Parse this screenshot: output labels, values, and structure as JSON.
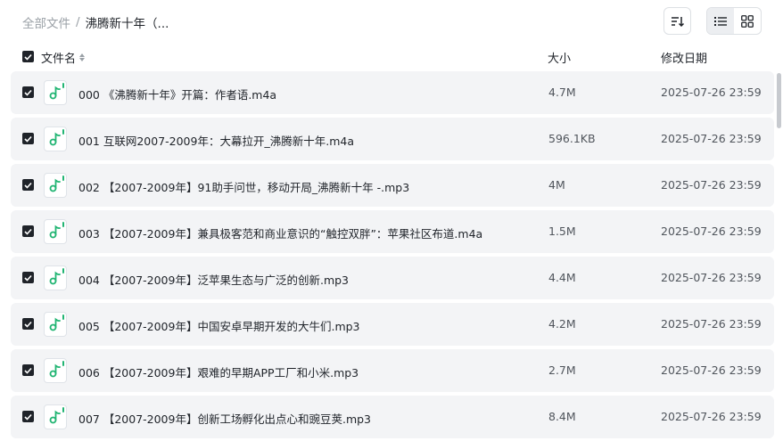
{
  "breadcrumb": {
    "root": "全部文件",
    "separator": "/",
    "current": "沸腾新十年（..."
  },
  "toolbar": {
    "sort_icon": "sort-icon",
    "list_view_icon": "list-view-icon",
    "grid_view_icon": "grid-view-icon",
    "active_view": "list"
  },
  "table": {
    "headers": {
      "name": "文件名",
      "size": "大小",
      "date": "修改日期"
    },
    "rows": [
      {
        "name": "000 《沸腾新十年》开篇：作者语.m4a",
        "size": "4.7M",
        "date": "2025-07-26 23:59",
        "checked": true
      },
      {
        "name": "001 互联网2007-2009年：大幕拉开_沸腾新十年.m4a",
        "size": "596.1KB",
        "date": "2025-07-26 23:59",
        "checked": true
      },
      {
        "name": "002 【2007-2009年】91助手问世，移动开局_沸腾新十年 -.mp3",
        "size": "4M",
        "date": "2025-07-26 23:59",
        "checked": true
      },
      {
        "name": "003 【2007-2009年】兼具极客范和商业意识的“触控双胖”：苹果社区布道.m4a",
        "size": "1.5M",
        "date": "2025-07-26 23:59",
        "checked": true
      },
      {
        "name": "004 【2007-2009年】泛苹果生态与广泛的创新.mp3",
        "size": "4.4M",
        "date": "2025-07-26 23:59",
        "checked": true
      },
      {
        "name": "005 【2007-2009年】中国安卓早期开发的大牛们.mp3",
        "size": "4.2M",
        "date": "2025-07-26 23:59",
        "checked": true
      },
      {
        "name": "006 【2007-2009年】艰难的早期APP工厂和小米.mp3",
        "size": "2.7M",
        "date": "2025-07-26 23:59",
        "checked": true
      },
      {
        "name": "007 【2007-2009年】创新工场孵化出点心和豌豆荚.mp3",
        "size": "8.4M",
        "date": "2025-07-26 23:59",
        "checked": true
      }
    ]
  },
  "colors": {
    "accent_green": "#22b573",
    "row_bg": "#f3f4f6",
    "checkbox": "#1f2329"
  }
}
